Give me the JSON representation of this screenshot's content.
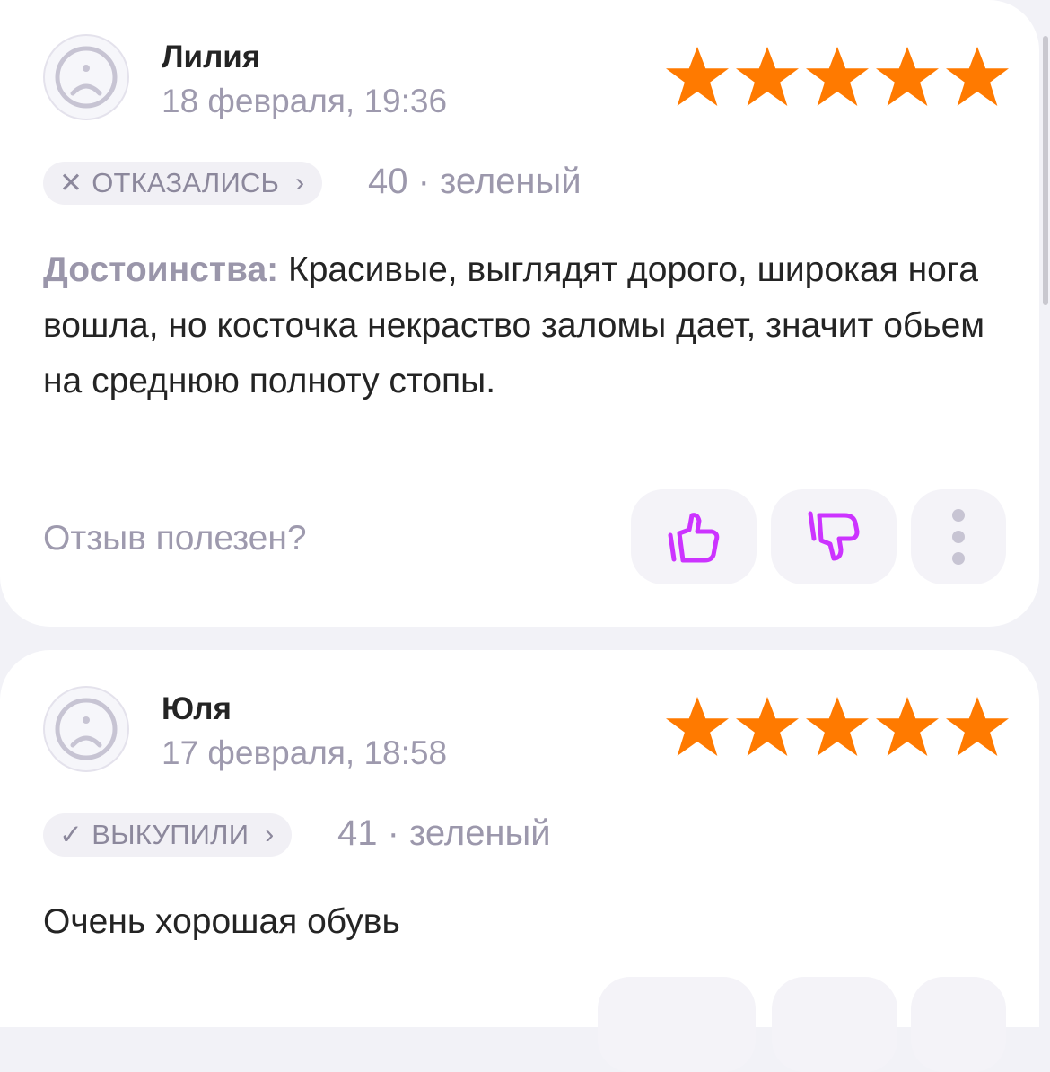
{
  "reviews": [
    {
      "author": "Лилия",
      "date": "18 февраля, 19:36",
      "rating": 5,
      "status_mark": "✕",
      "status": "ОТКАЗАЛИСЬ",
      "status_chevron": "›",
      "variant": "40 · зеленый",
      "pros_label": "Достоинства:",
      "text": " Красивые, выглядят дорого, широкая нога вошла, но косточка некраство заломы дает, значит обьем на среднюю полноту стопы.",
      "helpful_question": "Отзыв полезен?"
    },
    {
      "author": "Юля",
      "date": "17 февраля, 18:58",
      "rating": 5,
      "status_mark": "✓",
      "status": "ВЫКУПИЛИ",
      "status_chevron": "›",
      "variant": "41 · зеленый",
      "text": "Очень хорошая обувь"
    }
  ],
  "colors": {
    "star": "#ff7a00",
    "accent": "#cc33ff",
    "muted": "#9e9aae"
  },
  "icons": {
    "avatar": "sad-face-icon",
    "like": "thumbs-up-icon",
    "dislike": "thumbs-down-icon",
    "more": "vertical-dots-icon",
    "rating": "star-icon"
  }
}
